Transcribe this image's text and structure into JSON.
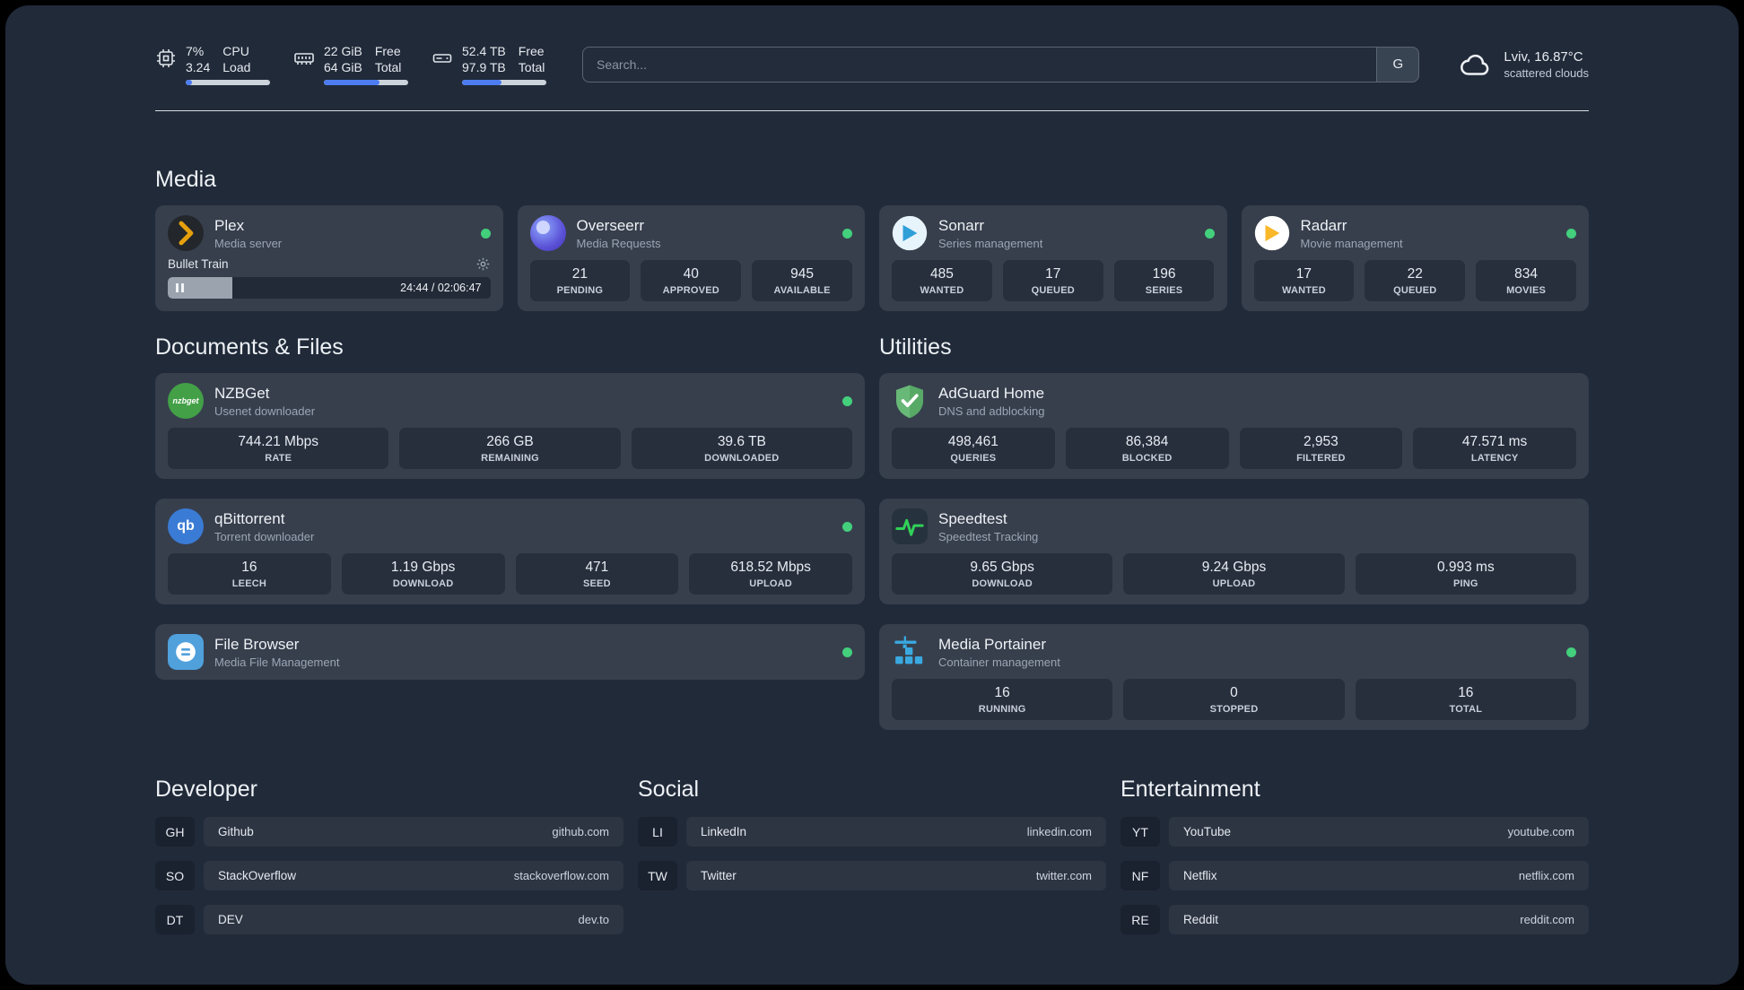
{
  "header": {
    "metrics": [
      {
        "name": "cpu",
        "top_value": "7%",
        "bottom_value": "3.24",
        "top_label": "CPU",
        "bottom_label": "Load",
        "bar_percent": 7
      },
      {
        "name": "memory",
        "top_value": "22 GiB",
        "bottom_value": "64 GiB",
        "top_label": "Free",
        "bottom_label": "Total",
        "bar_percent": 66
      },
      {
        "name": "storage",
        "top_value": "52.4 TB",
        "bottom_value": "97.9 TB",
        "top_label": "Free",
        "bottom_label": "Total",
        "bar_percent": 47
      }
    ],
    "search": {
      "placeholder": "Search...",
      "engine_button": "G"
    },
    "weather": {
      "location": "Lviv, 16.87°C",
      "condition": "scattered clouds"
    }
  },
  "media": {
    "title": "Media",
    "plex": {
      "name": "Plex",
      "subtitle": "Media server",
      "status": "online",
      "now_playing": "Bullet Train",
      "time": "24:44 / 02:06:47",
      "progress_percent": 20
    },
    "overseerr": {
      "name": "Overseerr",
      "subtitle": "Media Requests",
      "status": "online",
      "stats": [
        {
          "value": "21",
          "label": "PENDING"
        },
        {
          "value": "40",
          "label": "APPROVED"
        },
        {
          "value": "945",
          "label": "AVAILABLE"
        }
      ]
    },
    "sonarr": {
      "name": "Sonarr",
      "subtitle": "Series management",
      "status": "online",
      "stats": [
        {
          "value": "485",
          "label": "WANTED"
        },
        {
          "value": "17",
          "label": "QUEUED"
        },
        {
          "value": "196",
          "label": "SERIES"
        }
      ]
    },
    "radarr": {
      "name": "Radarr",
      "subtitle": "Movie management",
      "status": "online",
      "stats": [
        {
          "value": "17",
          "label": "WANTED"
        },
        {
          "value": "22",
          "label": "QUEUED"
        },
        {
          "value": "834",
          "label": "MOVIES"
        }
      ]
    }
  },
  "documents": {
    "title": "Documents & Files",
    "nzbget": {
      "name": "NZBGet",
      "subtitle": "Usenet downloader",
      "status": "online",
      "icon_text": "nzbget",
      "stats": [
        {
          "value": "744.21 Mbps",
          "label": "RATE"
        },
        {
          "value": "266 GB",
          "label": "REMAINING"
        },
        {
          "value": "39.6 TB",
          "label": "DOWNLOADED"
        }
      ]
    },
    "qbittorrent": {
      "name": "qBittorrent",
      "subtitle": "Torrent downloader",
      "status": "online",
      "icon_text": "qb",
      "stats": [
        {
          "value": "16",
          "label": "LEECH"
        },
        {
          "value": "1.19 Gbps",
          "label": "DOWNLOAD"
        },
        {
          "value": "471",
          "label": "SEED"
        },
        {
          "value": "618.52 Mbps",
          "label": "UPLOAD"
        }
      ]
    },
    "filebrowser": {
      "name": "File Browser",
      "subtitle": "Media File Management",
      "status": "online"
    }
  },
  "utilities": {
    "title": "Utilities",
    "adguard": {
      "name": "AdGuard Home",
      "subtitle": "DNS and adblocking",
      "stats": [
        {
          "value": "498,461",
          "label": "QUERIES"
        },
        {
          "value": "86,384",
          "label": "BLOCKED"
        },
        {
          "value": "2,953",
          "label": "FILTERED"
        },
        {
          "value": "47.571 ms",
          "label": "LATENCY"
        }
      ]
    },
    "speedtest": {
      "name": "Speedtest",
      "subtitle": "Speedtest Tracking",
      "stats": [
        {
          "value": "9.65 Gbps",
          "label": "DOWNLOAD"
        },
        {
          "value": "9.24 Gbps",
          "label": "UPLOAD"
        },
        {
          "value": "0.993 ms",
          "label": "PING"
        }
      ]
    },
    "portainer": {
      "name": "Media Portainer",
      "subtitle": "Container management",
      "status": "online",
      "stats": [
        {
          "value": "16",
          "label": "RUNNING"
        },
        {
          "value": "0",
          "label": "STOPPED"
        },
        {
          "value": "16",
          "label": "TOTAL"
        }
      ]
    }
  },
  "bookmarks": {
    "developer": {
      "title": "Developer",
      "items": [
        {
          "abbr": "GH",
          "name": "Github",
          "url": "github.com"
        },
        {
          "abbr": "SO",
          "name": "StackOverflow",
          "url": "stackoverflow.com"
        },
        {
          "abbr": "DT",
          "name": "DEV",
          "url": "dev.to"
        }
      ]
    },
    "social": {
      "title": "Social",
      "items": [
        {
          "abbr": "LI",
          "name": "LinkedIn",
          "url": "linkedin.com"
        },
        {
          "abbr": "TW",
          "name": "Twitter",
          "url": "twitter.com"
        }
      ]
    },
    "entertainment": {
      "title": "Entertainment",
      "items": [
        {
          "abbr": "YT",
          "name": "YouTube",
          "url": "youtube.com"
        },
        {
          "abbr": "NF",
          "name": "Netflix",
          "url": "netflix.com"
        },
        {
          "abbr": "RE",
          "name": "Reddit",
          "url": "reddit.com"
        }
      ]
    }
  },
  "colors": {
    "status_online": "#43cf7c",
    "bar_fill": "#4d7cf0",
    "background": "#212a39",
    "card": "#373f4d"
  }
}
